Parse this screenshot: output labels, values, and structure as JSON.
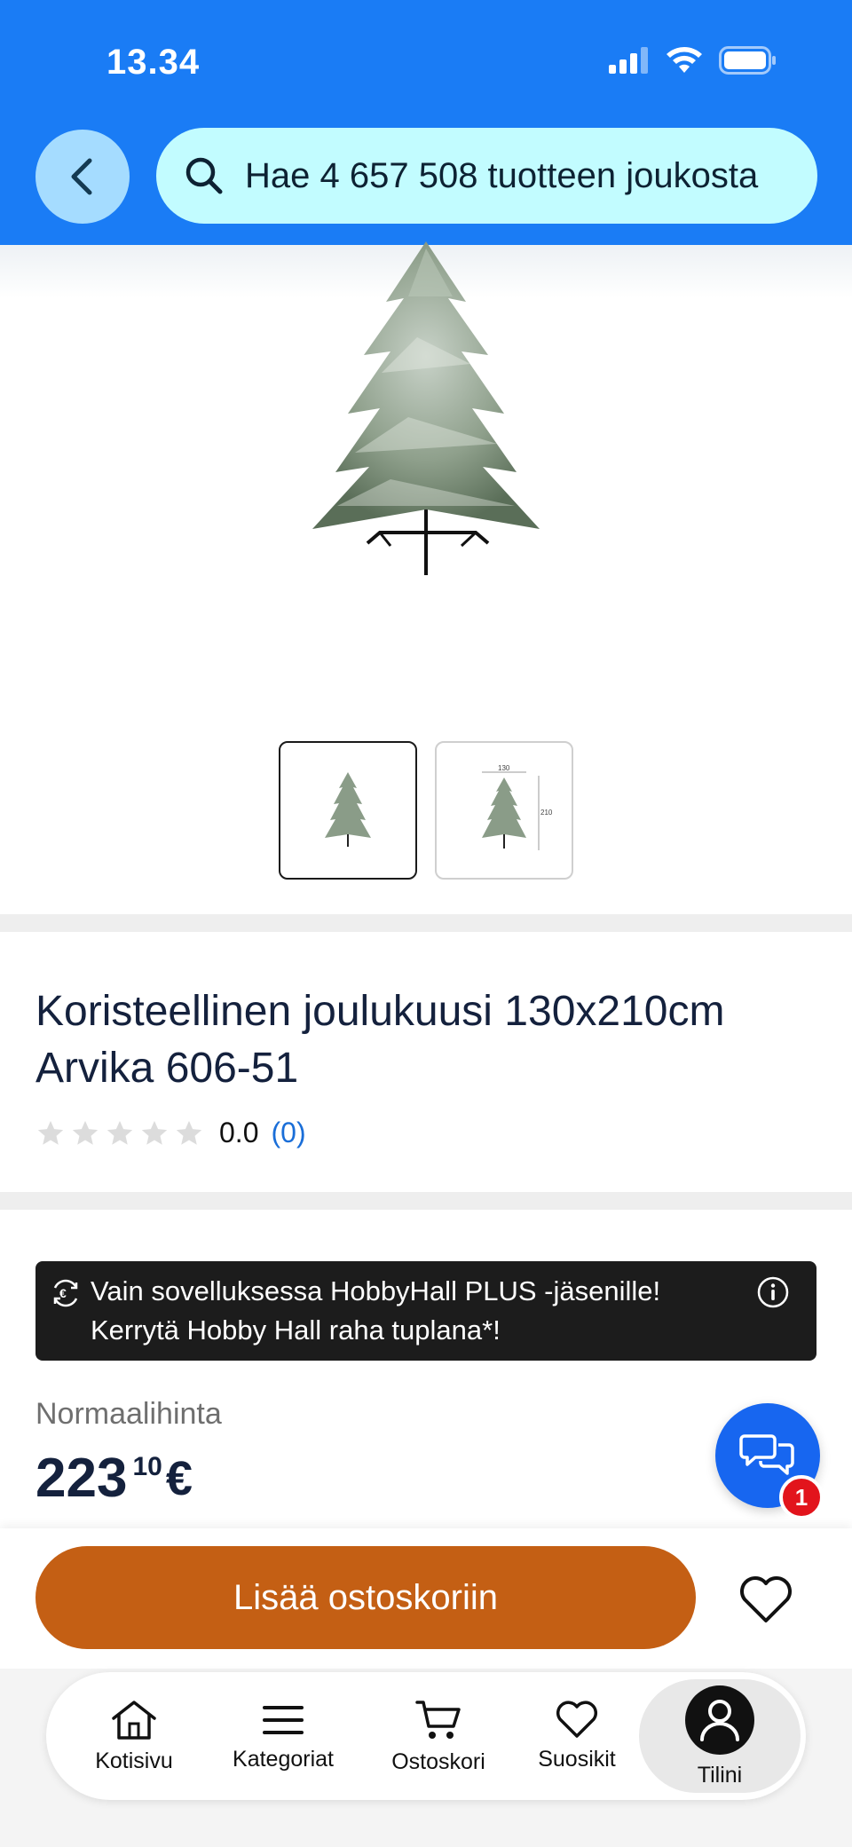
{
  "status_bar": {
    "time": "13.34"
  },
  "search": {
    "placeholder": "Hae 4 657 508 tuotteen joukosta"
  },
  "product": {
    "title": "Koristeellinen joulukuusi 130x210cm Arvika 606-51",
    "rating_value": "0.0",
    "rating_count": "(0)",
    "rating_stars_filled": 0,
    "thumbnails": [
      {
        "name": "thumbnail-tree",
        "selected": true
      },
      {
        "name": "thumbnail-tree-dimensions",
        "selected": false,
        "width_label": "130",
        "height_label": "210"
      }
    ]
  },
  "promo": {
    "line1": "Vain sovelluksessa HobbyHall PLUS -jäsenille!",
    "line2": "Kerrytä Hobby Hall raha tuplana*!"
  },
  "price": {
    "label": "Normaalihinta",
    "integer": "223",
    "decimals": "10",
    "currency": "€"
  },
  "chat": {
    "badge_count": "1"
  },
  "cart": {
    "add_label": "Lisää ostoskoriin"
  },
  "nav": {
    "items": [
      {
        "label": "Kotisivu",
        "icon": "home-icon"
      },
      {
        "label": "Kategoriat",
        "icon": "menu-icon"
      },
      {
        "label": "Ostoskori",
        "icon": "cart-icon"
      },
      {
        "label": "Suosikit",
        "icon": "heart-icon"
      },
      {
        "label": "Tilini",
        "icon": "account-icon",
        "active": true
      }
    ]
  },
  "colors": {
    "header_blue": "#1a7cf5",
    "search_bg": "#c2fcff",
    "add_to_cart": "#c45f14",
    "promo_bg": "#1c1c1c",
    "chat_blue": "#1766f0",
    "badge_red": "#e2141c"
  }
}
